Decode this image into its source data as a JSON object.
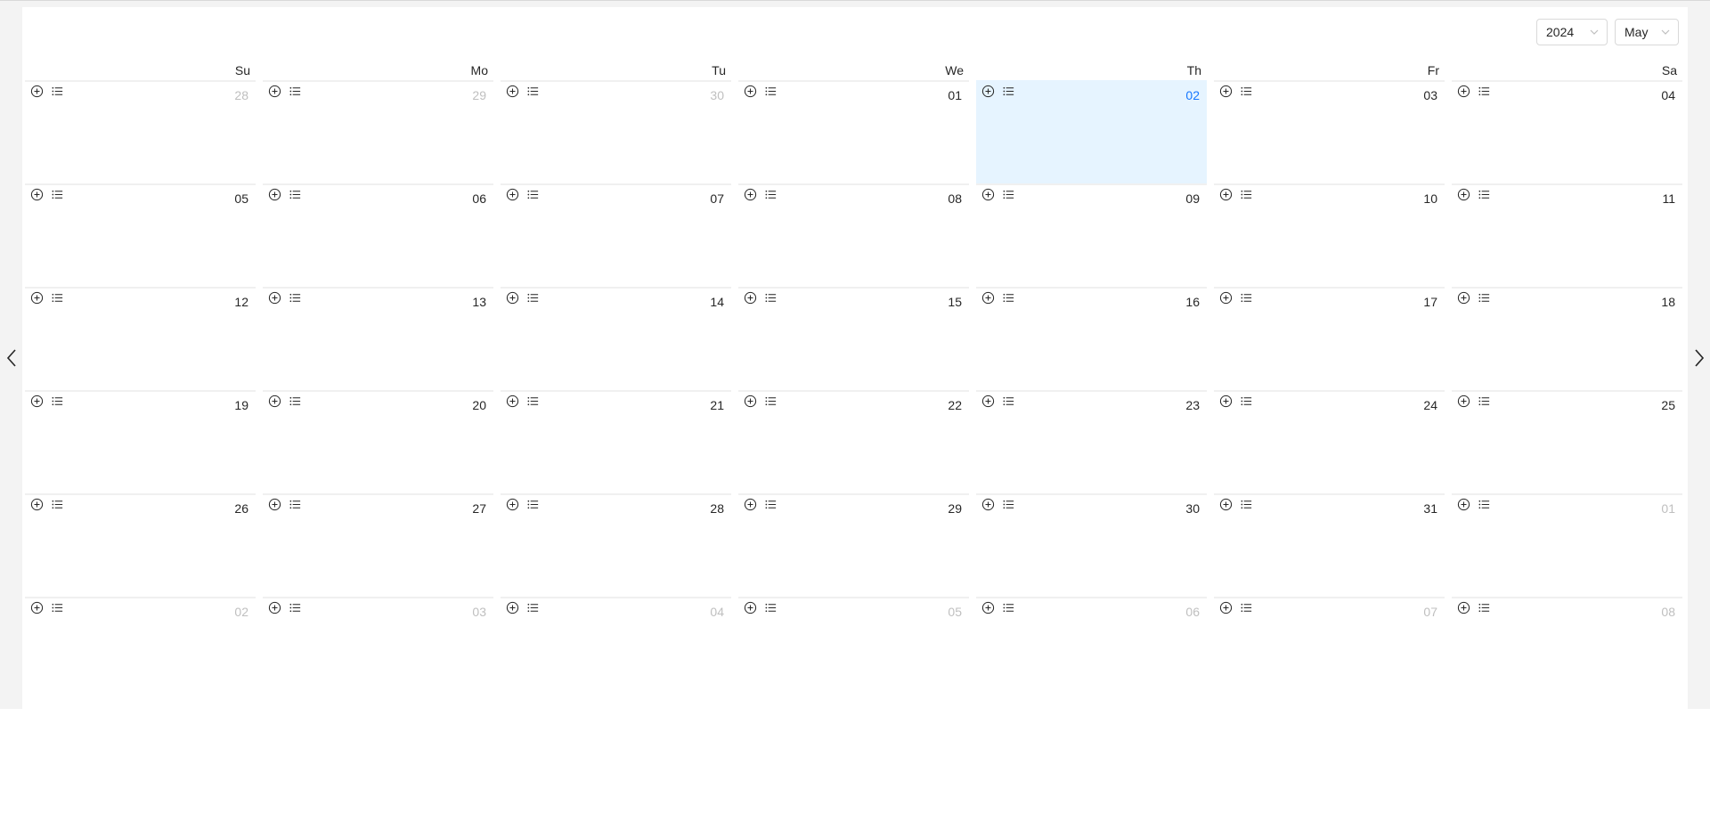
{
  "controls": {
    "year": "2024",
    "month": "May"
  },
  "weekdays": [
    "Su",
    "Mo",
    "Tu",
    "We",
    "Th",
    "Fr",
    "Sa"
  ],
  "icons": {
    "prev": "chevron-left-icon",
    "next": "chevron-right-icon",
    "add": "plus-circle-icon",
    "list": "list-icon"
  },
  "colors": {
    "today_bg": "#e6f4ff",
    "today_text": "#1677ff",
    "muted_text": "#bfbfbf"
  },
  "weeks": [
    [
      {
        "d": "28",
        "other": true
      },
      {
        "d": "29",
        "other": true
      },
      {
        "d": "30",
        "other": true
      },
      {
        "d": "01"
      },
      {
        "d": "02",
        "today": true
      },
      {
        "d": "03"
      },
      {
        "d": "04"
      }
    ],
    [
      {
        "d": "05"
      },
      {
        "d": "06"
      },
      {
        "d": "07"
      },
      {
        "d": "08"
      },
      {
        "d": "09"
      },
      {
        "d": "10"
      },
      {
        "d": "11"
      }
    ],
    [
      {
        "d": "12"
      },
      {
        "d": "13"
      },
      {
        "d": "14"
      },
      {
        "d": "15"
      },
      {
        "d": "16"
      },
      {
        "d": "17"
      },
      {
        "d": "18"
      }
    ],
    [
      {
        "d": "19"
      },
      {
        "d": "20"
      },
      {
        "d": "21"
      },
      {
        "d": "22"
      },
      {
        "d": "23"
      },
      {
        "d": "24"
      },
      {
        "d": "25"
      }
    ],
    [
      {
        "d": "26"
      },
      {
        "d": "27"
      },
      {
        "d": "28"
      },
      {
        "d": "29"
      },
      {
        "d": "30"
      },
      {
        "d": "31"
      },
      {
        "d": "01",
        "other": true
      }
    ],
    [
      {
        "d": "02",
        "other": true
      },
      {
        "d": "03",
        "other": true
      },
      {
        "d": "04",
        "other": true
      },
      {
        "d": "05",
        "other": true
      },
      {
        "d": "06",
        "other": true
      },
      {
        "d": "07",
        "other": true
      },
      {
        "d": "08",
        "other": true
      }
    ]
  ]
}
